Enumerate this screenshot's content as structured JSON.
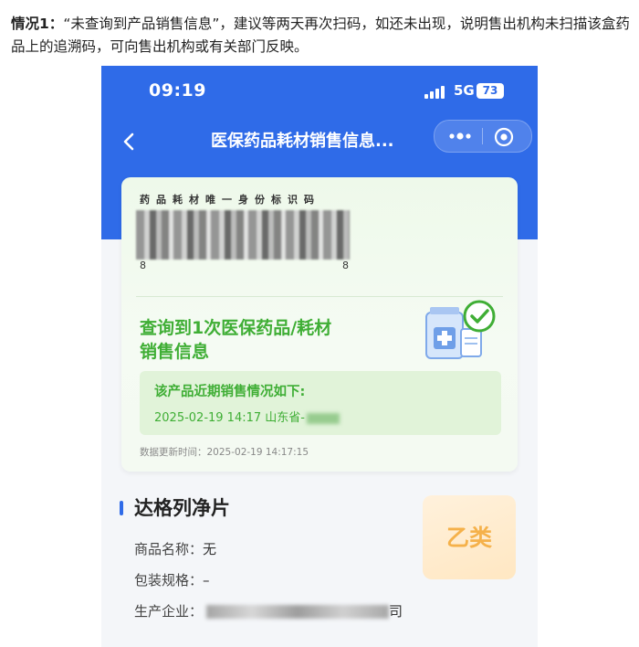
{
  "intro": {
    "label": "情况1",
    "text": "“未查询到产品销售信息”，建议等两天再次扫码，如还未出现，说明售出机构未扫描该盒药品上的追溯码，可向售出机构或有关部门反映。"
  },
  "status_bar": {
    "time": "09:19",
    "network": "5G",
    "battery": "73"
  },
  "nav": {
    "title": "医保药品耗材销售信息..."
  },
  "card": {
    "code_label": "药品耗材唯一身份标识码",
    "code_first_digit": "8",
    "code_last_digit": "8",
    "found_line1": "查询到1次医保药品/耗材",
    "found_line2": "销售信息",
    "sales_title": "该产品近期销售情况如下:",
    "sales_record": "2025-02-19 14:17 山东省-",
    "update_time": "数据更新时间：2025-02-19 14:17:15"
  },
  "product": {
    "name": "达格列净片",
    "category": "乙类",
    "fields": [
      {
        "label": "商品名称：",
        "value": "无"
      },
      {
        "label": "包装规格：",
        "value": "–"
      },
      {
        "label": "生产企业：",
        "value": "司"
      }
    ]
  },
  "colors": {
    "brand_blue": "#2f6be8",
    "success_green": "#3fae35",
    "category_orange": "#f5b14a"
  },
  "icons": [
    "back-icon",
    "more-icon",
    "target-icon",
    "signal-icon",
    "medicine-check-icon"
  ]
}
